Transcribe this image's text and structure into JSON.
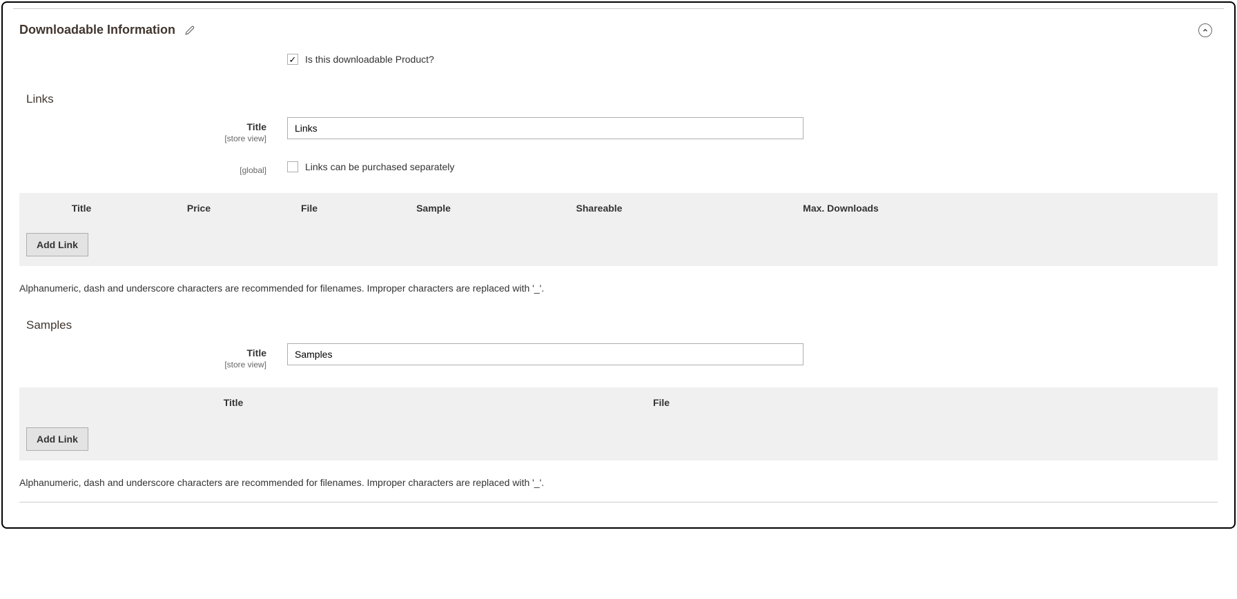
{
  "section": {
    "title": "Downloadable Information"
  },
  "is_downloadable": {
    "label": "Is this downloadable Product?",
    "checked": true
  },
  "links": {
    "section_title": "Links",
    "title_label": "Title",
    "title_scope": "[store view]",
    "title_value": "Links",
    "purchased_separately_scope": "[global]",
    "purchased_separately_label": "Links can be purchased separately",
    "purchased_separately_checked": false,
    "columns": {
      "title": "Title",
      "price": "Price",
      "file": "File",
      "sample": "Sample",
      "shareable": "Shareable",
      "max_downloads": "Max. Downloads"
    },
    "add_button": "Add Link",
    "note": "Alphanumeric, dash and underscore characters are recommended for filenames. Improper characters are replaced with '_'."
  },
  "samples": {
    "section_title": "Samples",
    "title_label": "Title",
    "title_scope": "[store view]",
    "title_value": "Samples",
    "columns": {
      "title": "Title",
      "file": "File"
    },
    "add_button": "Add Link",
    "note": "Alphanumeric, dash and underscore characters are recommended for filenames. Improper characters are replaced with '_'."
  }
}
